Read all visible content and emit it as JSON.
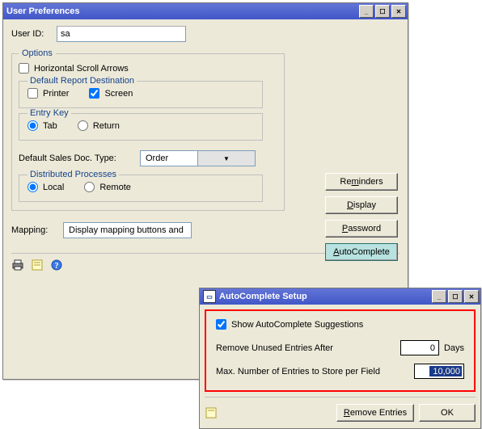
{
  "win1": {
    "title": "User Preferences",
    "user_id_label": "User ID:",
    "user_id_value": "sa",
    "options_label": "Options",
    "horiz_scroll": "Horizontal Scroll Arrows",
    "report_dest_label": "Default Report Destination",
    "printer": "Printer",
    "screen": "Screen",
    "entry_key_label": "Entry Key",
    "tab": "Tab",
    "return": "Return",
    "sales_doc_label": "Default Sales Doc. Type:",
    "sales_doc_value": "Order",
    "dist_proc_label": "Distributed Processes",
    "local": "Local",
    "remote": "Remote",
    "mapping_label": "Mapping:",
    "mapping_value": "Display mapping buttons and",
    "btn": {
      "reminders": "Reminders",
      "display": "Display",
      "password": "Password",
      "autocomplete": "AutoComplete"
    }
  },
  "win2": {
    "title": "AutoComplete Setup",
    "show_suggestions": "Show AutoComplete Suggestions",
    "remove_after_label": "Remove Unused Entries After",
    "remove_after_value": "0",
    "remove_after_unit": "Days",
    "max_entries_label": "Max. Number of Entries to Store per Field",
    "max_entries_value": "10,000",
    "btn_remove": "Remove Entries",
    "btn_ok": "OK"
  }
}
